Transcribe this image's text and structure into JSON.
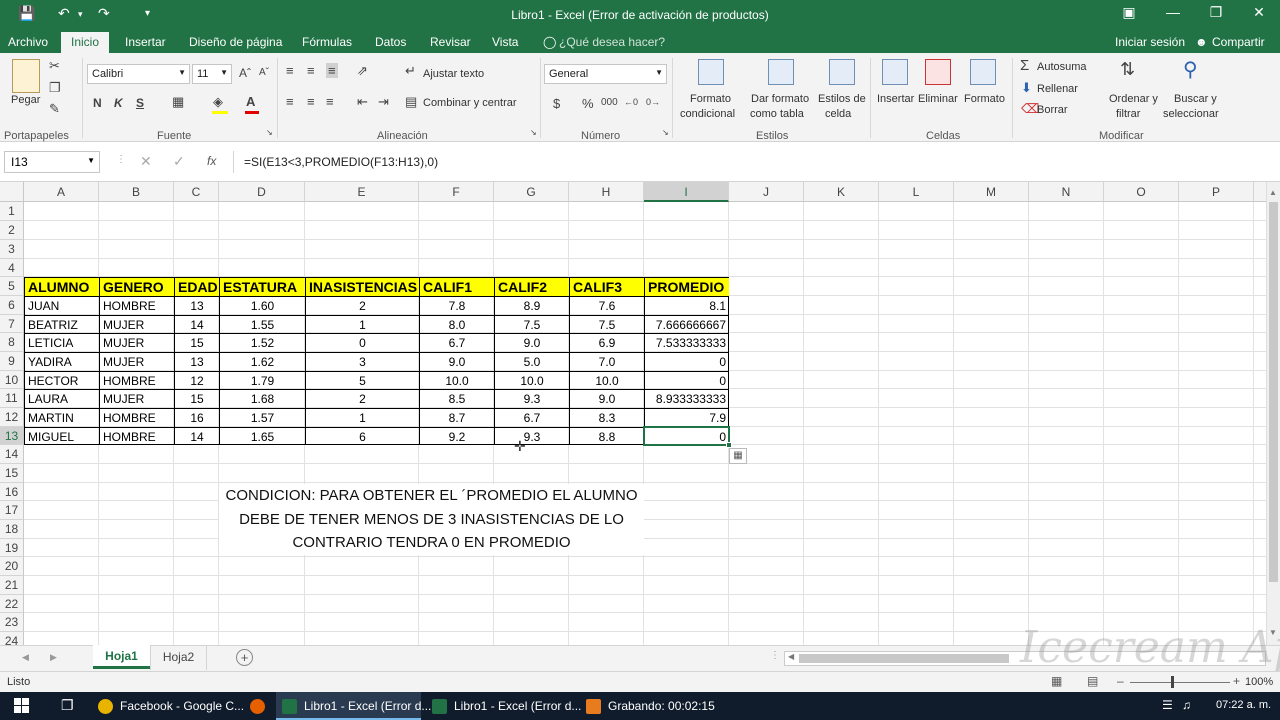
{
  "window": {
    "title": "Libro1 - Excel (Error de activación de productos)"
  },
  "menu": {
    "items": [
      "Archivo",
      "Inicio",
      "Insertar",
      "Diseño de página",
      "Fórmulas",
      "Datos",
      "Revisar",
      "Vista"
    ],
    "tell_me": "¿Qué desea hacer?",
    "sign_in": "Iniciar sesión",
    "share": "Compartir"
  },
  "ribbon": {
    "paste": "Pegar",
    "font_name": "Calibri",
    "font_size": "11",
    "bold": "N",
    "italic": "K",
    "underline": "S",
    "wrap_text": "Ajustar texto",
    "merge_center": "Combinar y centrar",
    "number_format": "General",
    "percent": "%",
    "thousands": "000",
    "cond_format": [
      "Formato",
      "condicional"
    ],
    "format_table": [
      "Dar formato",
      "como tabla"
    ],
    "cell_styles": [
      "Estilos de",
      "celda"
    ],
    "insert": "Insertar",
    "delete": "Eliminar",
    "format": "Formato",
    "autosum": "Autosuma",
    "fill": "Rellenar",
    "clear": "Borrar",
    "sort_filter": [
      "Ordenar y",
      "filtrar"
    ],
    "find_select": [
      "Buscar y",
      "seleccionar"
    ],
    "groups": [
      "Portapapeles",
      "Fuente",
      "Alineación",
      "Número",
      "Estilos",
      "Celdas",
      "Modificar"
    ]
  },
  "formula_bar": {
    "name_box": "I13",
    "fx": "fx",
    "formula": "=SI(E13<3,PROMEDIO(F13:H13),0)"
  },
  "grid": {
    "columns": [
      "A",
      "B",
      "C",
      "D",
      "E",
      "F",
      "G",
      "H",
      "I",
      "J",
      "K",
      "L",
      "M",
      "N",
      "O",
      "P"
    ],
    "rows": [
      "1",
      "2",
      "3",
      "4",
      "5",
      "6",
      "7",
      "8",
      "9",
      "10",
      "11",
      "12",
      "13",
      "14",
      "15",
      "16",
      "17",
      "18",
      "19",
      "20",
      "21",
      "22",
      "23",
      "24"
    ],
    "selected_cell": "I13"
  },
  "table": {
    "headers": [
      "ALUMNO",
      "GENERO",
      "EDAD",
      "ESTATURA",
      "INASISTENCIAS",
      "CALIF1",
      "CALIF2",
      "CALIF3",
      "PROMEDIO"
    ],
    "rows": [
      [
        "JUAN",
        "HOMBRE",
        "13",
        "1.60",
        "2",
        "7.8",
        "8.9",
        "7.6",
        "8.1"
      ],
      [
        "BEATRIZ",
        "MUJER",
        "14",
        "1.55",
        "1",
        "8.0",
        "7.5",
        "7.5",
        "7.666666667"
      ],
      [
        "LETICIA",
        "MUJER",
        "15",
        "1.52",
        "0",
        "6.7",
        "9.0",
        "6.9",
        "7.533333333"
      ],
      [
        "YADIRA",
        "MUJER",
        "13",
        "1.62",
        "3",
        "9.0",
        "5.0",
        "7.0",
        "0"
      ],
      [
        "HECTOR",
        "HOMBRE",
        "12",
        "1.79",
        "5",
        "10.0",
        "10.0",
        "10.0",
        "0"
      ],
      [
        "LAURA",
        "MUJER",
        "15",
        "1.68",
        "2",
        "8.5",
        "9.3",
        "9.0",
        "8.933333333"
      ],
      [
        "MARTIN",
        "HOMBRE",
        "16",
        "1.57",
        "1",
        "8.7",
        "6.7",
        "8.3",
        "7.9"
      ],
      [
        "MIGUEL",
        "HOMBRE",
        "14",
        "1.65",
        "6",
        "9.2",
        "9.3",
        "8.8",
        "0"
      ]
    ]
  },
  "note": {
    "line1": "CONDICION: PARA OBTENER EL ´PROMEDIO EL ALUMNO",
    "line2": "DEBE DE TENER MENOS DE 3 INASISTENCIAS DE LO",
    "line3": "CONTRARIO TENDRA 0 EN PROMEDIO"
  },
  "sheets": [
    "Hoja1",
    "Hoja2"
  ],
  "status": {
    "ready": "Listo",
    "zoom": "100%"
  },
  "taskbar": {
    "items": [
      "Facebook - Google C...",
      "Libro1 - Excel (Error d...",
      "Libro1 - Excel (Error d...",
      "Grabando:  00:02:15"
    ],
    "time": "07:22 a. m."
  },
  "watermark": "Icecream Apps",
  "colors": {
    "excel_green": "#217346",
    "header_yellow": "#ffff00"
  }
}
